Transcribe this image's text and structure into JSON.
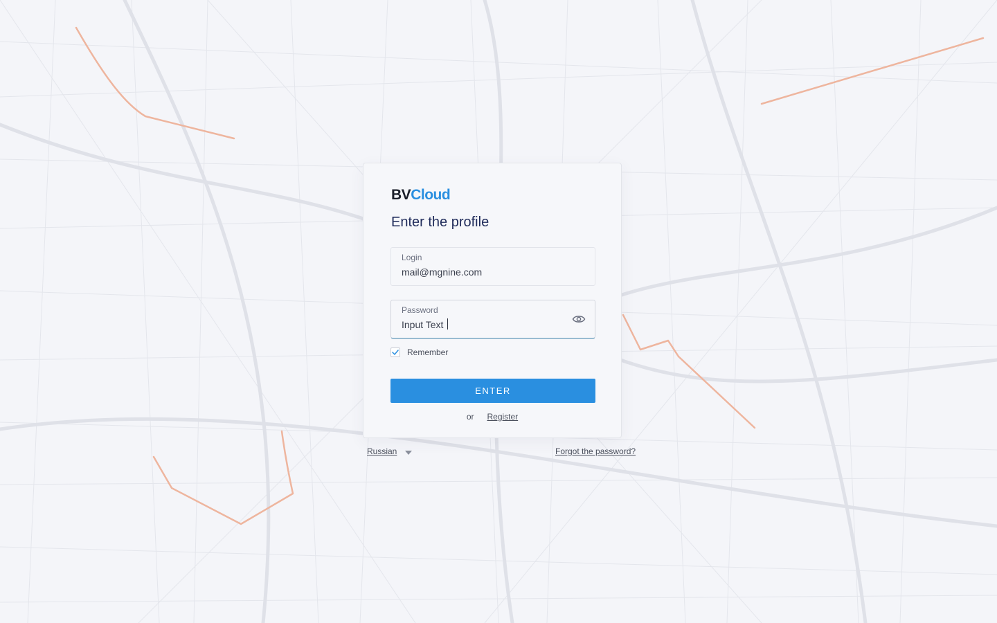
{
  "brand": {
    "logo_part1": "BV",
    "logo_part2": "Cloud",
    "primary_color": "#2a8fe0",
    "dark_color": "#1b1f2a"
  },
  "form": {
    "title": "Enter the profile",
    "login": {
      "label": "Login",
      "value": "mail@mgnine.com"
    },
    "password": {
      "label": "Password",
      "placeholder": "Input Text",
      "icon": "eye-icon"
    },
    "remember": {
      "label": "Remember",
      "checked": true,
      "icon": "checkmark-icon"
    },
    "submit_label": "ENTER",
    "or_text": "or",
    "register_label": "Register"
  },
  "footer": {
    "language_label": "Russian",
    "language_icon": "caret-down-icon",
    "forgot_label": "Forgot the password?"
  },
  "background": {
    "type": "city-map",
    "road_color": "#e3e5ec",
    "route_color": "#eeb59e"
  }
}
